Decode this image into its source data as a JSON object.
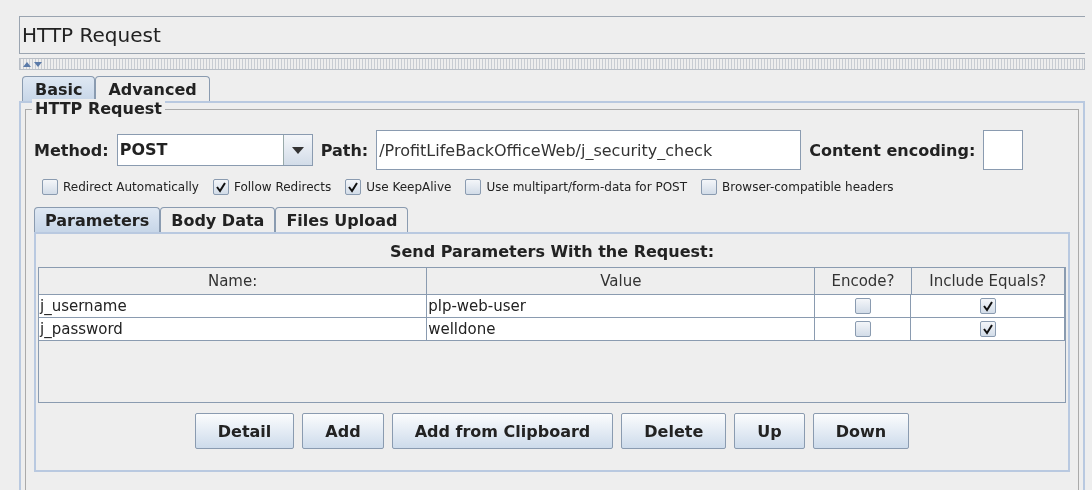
{
  "title": "HTTP Request",
  "tabs": [
    {
      "label": "Basic",
      "selected": true
    },
    {
      "label": "Advanced",
      "selected": false
    }
  ],
  "group_title": "HTTP Request",
  "method": {
    "label": "Method:",
    "value": "POST"
  },
  "path": {
    "label": "Path:",
    "value": "/ProfitLifeBackOfficeWeb/j_security_check"
  },
  "content_encoding": {
    "label": "Content encoding:"
  },
  "options": [
    {
      "label": "Redirect Automatically",
      "checked": false
    },
    {
      "label": "Follow Redirects",
      "checked": true
    },
    {
      "label": "Use KeepAlive",
      "checked": true
    },
    {
      "label": "Use multipart/form-data for POST",
      "checked": false
    },
    {
      "label": "Browser-compatible headers",
      "checked": false
    }
  ],
  "sub_tabs": [
    {
      "label": "Parameters",
      "selected": true
    },
    {
      "label": "Body Data",
      "selected": false
    },
    {
      "label": "Files Upload",
      "selected": false
    }
  ],
  "table": {
    "caption": "Send Parameters With the Request:",
    "columns": [
      "Name:",
      "Value",
      "Encode?",
      "Include Equals?"
    ],
    "rows": [
      {
        "name": "j_username",
        "value": "plp-web-user",
        "encode": false,
        "include_equals": true
      },
      {
        "name": "j_password",
        "value": "welldone",
        "encode": false,
        "include_equals": true
      }
    ]
  },
  "buttons": [
    "Detail",
    "Add",
    "Add from Clipboard",
    "Delete",
    "Up",
    "Down"
  ]
}
